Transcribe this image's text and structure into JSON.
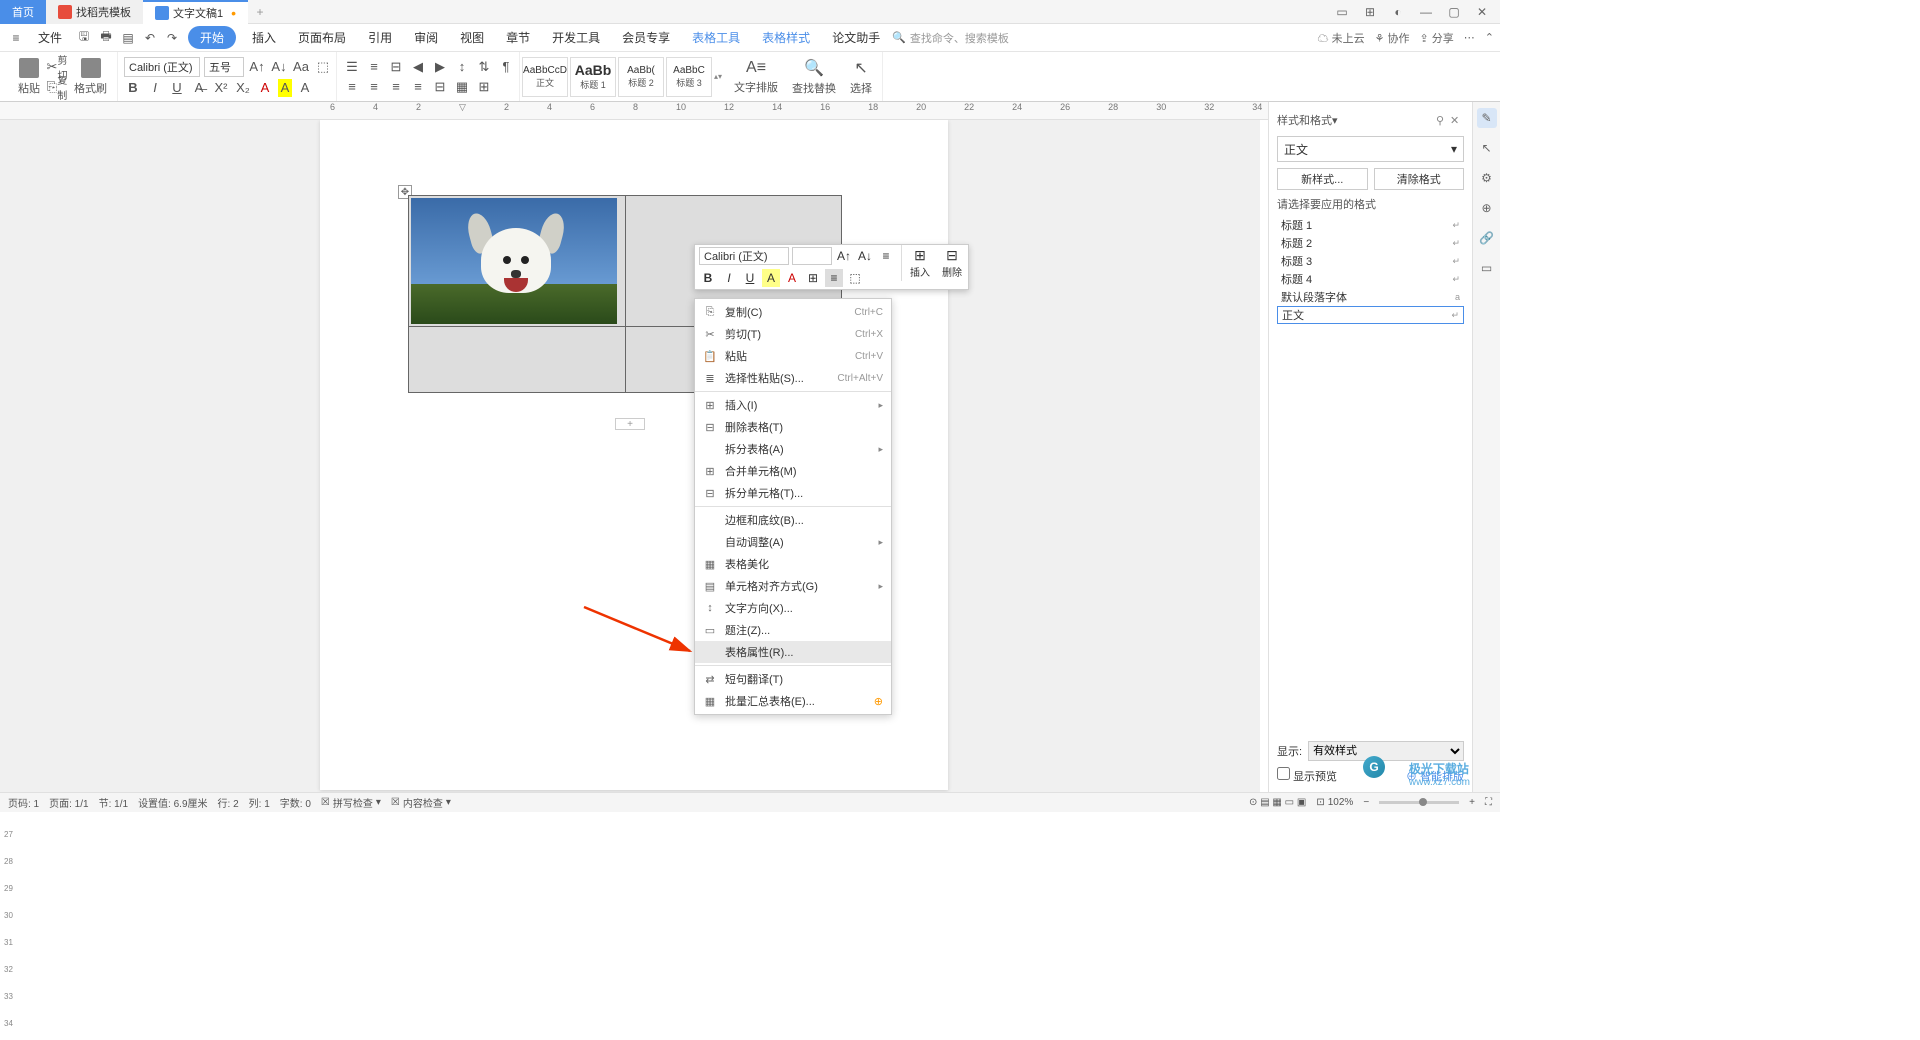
{
  "tabs": {
    "home": "首页",
    "template": "找稻壳模板",
    "doc": "文字文稿1"
  },
  "menubar": {
    "file": "文件",
    "start": "开始",
    "insert": "插入",
    "layout": "页面布局",
    "reference": "引用",
    "review": "审阅",
    "view": "视图",
    "chapter": "章节",
    "dev": "开发工具",
    "member": "会员专享",
    "table_tools": "表格工具",
    "table_style": "表格样式",
    "thesis": "论文助手",
    "search_placeholder": "查找命令、搜索模板",
    "not_cloud": "未上云",
    "collaborate": "协作",
    "share": "分享"
  },
  "ribbon": {
    "paste": "粘贴",
    "cut": "剪切",
    "copy": "复制",
    "format_painter": "格式刷",
    "font_name": "Calibri (正文)",
    "font_size": "五号",
    "styles": {
      "body": "正文",
      "h1": "标题 1",
      "h2": "标题 2",
      "h3": "标题 3"
    },
    "text_layout": "文字排版",
    "find_replace": "查找替换",
    "select": "选择"
  },
  "mini": {
    "font": "Calibri (正文)",
    "insert": "插入",
    "delete": "删除"
  },
  "context": {
    "copy": "复制(C)",
    "copy_key": "Ctrl+C",
    "cut": "剪切(T)",
    "cut_key": "Ctrl+X",
    "paste": "粘贴",
    "paste_key": "Ctrl+V",
    "paste_special": "选择性粘贴(S)...",
    "paste_special_key": "Ctrl+Alt+V",
    "insert": "插入(I)",
    "delete_table": "删除表格(T)",
    "split_table": "拆分表格(A)",
    "merge_cells": "合并单元格(M)",
    "split_cells": "拆分单元格(T)...",
    "borders": "边框和底纹(B)...",
    "auto_adjust": "自动调整(A)",
    "beautify": "表格美化",
    "cell_align": "单元格对齐方式(G)",
    "text_direction": "文字方向(X)...",
    "caption": "题注(Z)...",
    "table_props": "表格属性(R)...",
    "translate": "短句翻译(T)",
    "batch_tables": "批量汇总表格(E)..."
  },
  "panel": {
    "title": "样式和格式",
    "current": "正文",
    "new_style": "新样式...",
    "clear": "清除格式",
    "choose": "请选择要应用的格式",
    "h1": "标题 1",
    "h2": "标题 2",
    "h3": "标题 3",
    "h4": "标题 4",
    "default_font": "默认段落字体",
    "body": "正文",
    "show": "显示:",
    "show_value": "有效样式",
    "preview": "显示预览",
    "smart": "智能排版"
  },
  "status": {
    "page_no": "页码: 1",
    "page": "页面: 1/1",
    "section": "节: 1/1",
    "pos": "设置值: 6.9厘米",
    "line": "行: 2",
    "col": "列: 1",
    "words": "字数: 0",
    "spell": "拼写检查",
    "content": "内容检查",
    "zoom": "102%"
  },
  "watermark": {
    "site": "极光下载站",
    "url": "www.xz7.com"
  }
}
